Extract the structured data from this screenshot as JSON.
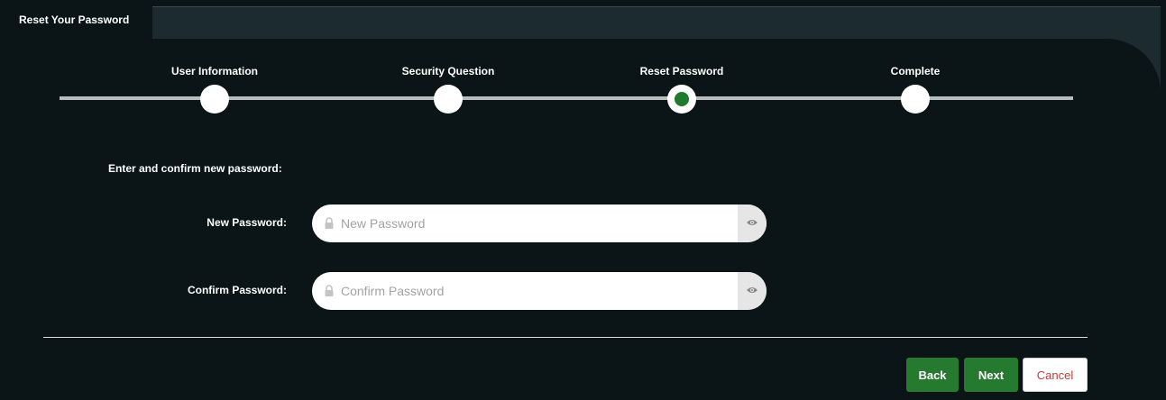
{
  "tab": {
    "title": "Reset Your Password"
  },
  "steps": [
    {
      "label": "User Information"
    },
    {
      "label": "Security Question"
    },
    {
      "label": "Reset Password"
    },
    {
      "label": "Complete"
    }
  ],
  "active_step": "Reset Password",
  "form": {
    "instruction": "Enter and confirm new password:",
    "new_password": {
      "label": "New Password:",
      "placeholder": "New Password",
      "value": ""
    },
    "confirm_password": {
      "label": "Confirm Password:",
      "placeholder": "Confirm Password",
      "value": ""
    }
  },
  "buttons": {
    "back": "Back",
    "next": "Next",
    "cancel": "Cancel"
  },
  "colors": {
    "background": "#0b1518",
    "active_step": "#1f7a2e",
    "primary_button": "#267a2f",
    "cancel_text": "#c33b3b"
  },
  "icons": {
    "field_icon": "lock-icon",
    "toggle_icon": "eye-icon"
  }
}
